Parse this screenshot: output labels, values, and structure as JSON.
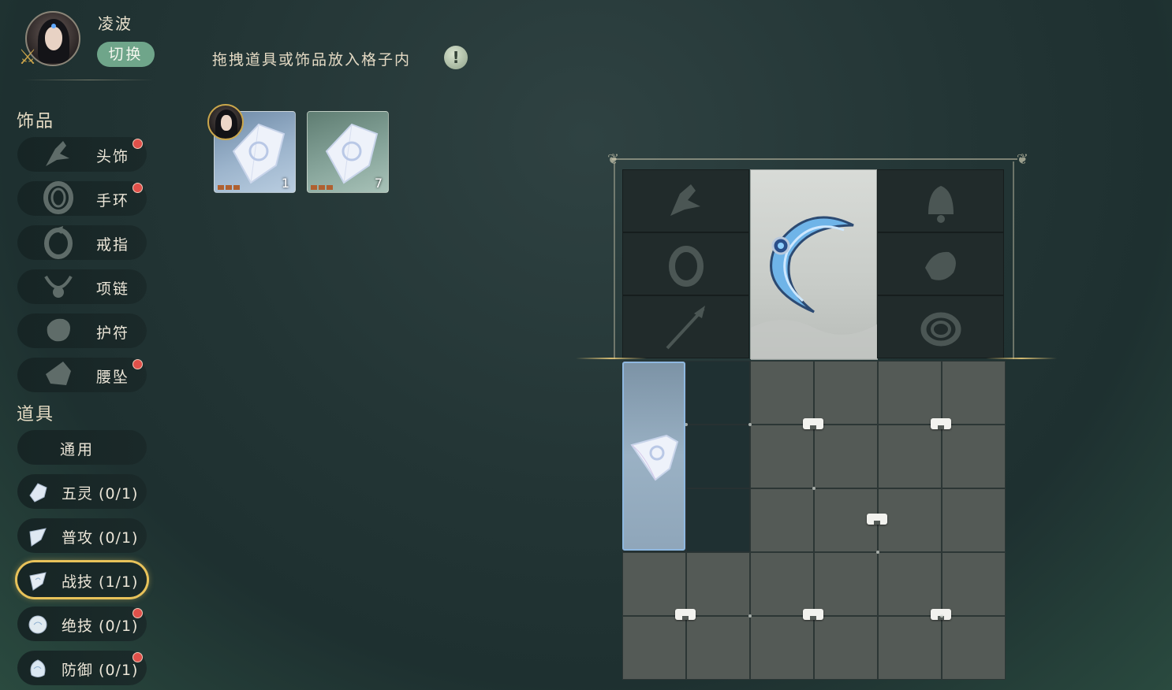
{
  "character": {
    "name": "凌波",
    "switch_label": "切换"
  },
  "sections": {
    "accessories_title": "饰品",
    "items_title": "道具"
  },
  "accessories": [
    {
      "label": "头饰",
      "icon": "headpiece-icon",
      "has_dot": true
    },
    {
      "label": "手环",
      "icon": "bracelet-icon",
      "has_dot": true
    },
    {
      "label": "戒指",
      "icon": "ring-icon",
      "has_dot": false
    },
    {
      "label": "项链",
      "icon": "necklace-icon",
      "has_dot": false
    },
    {
      "label": "护符",
      "icon": "amulet-icon",
      "has_dot": false
    },
    {
      "label": "腰坠",
      "icon": "waist-pendant-icon",
      "has_dot": true
    }
  ],
  "items": {
    "general_label": "通用",
    "list": [
      {
        "label": "五灵 (0/1)",
        "icon": "five-spirits-gem-icon",
        "active": false,
        "has_dot": false
      },
      {
        "label": "普攻 (0/1)",
        "icon": "normal-attack-gem-icon",
        "active": false,
        "has_dot": false
      },
      {
        "label": "战技 (1/1)",
        "icon": "battle-skill-gem-icon",
        "active": true,
        "has_dot": false
      },
      {
        "label": "绝技 (0/1)",
        "icon": "ultimate-gem-icon",
        "active": false,
        "has_dot": true
      },
      {
        "label": "防御 (0/1)",
        "icon": "defense-gem-icon",
        "active": false,
        "has_dot": true
      }
    ]
  },
  "instruction": {
    "text": "拖拽道具或饰品放入格子内",
    "info_icon": "!"
  },
  "inventory": [
    {
      "count": "1",
      "color": "blue",
      "equipped_by_character": true
    },
    {
      "count": "7",
      "color": "green",
      "equipped_by_character": false
    }
  ],
  "colors": {
    "switch_button": "#6fa58a",
    "active_outline": "#e8c25a",
    "notification_dot": "#e0504a",
    "placed_gem_border": "#8fb8e0"
  }
}
